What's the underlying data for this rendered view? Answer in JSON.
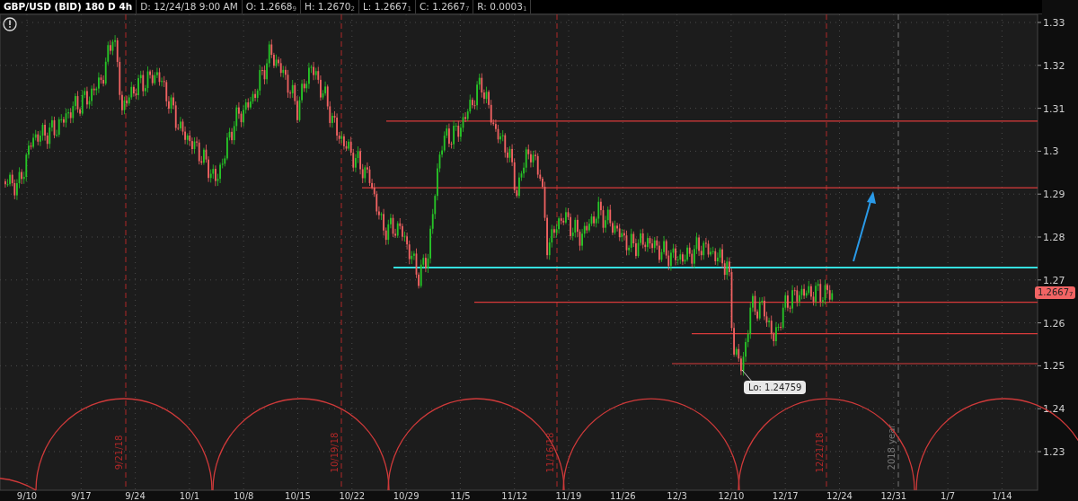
{
  "header": {
    "symbol": "GBP/USD (BID) 180 D 4h",
    "fields": [
      "D: 12/24/18 9:00 AM",
      "O: 1.2668$_{9}$",
      "H: 1.2670$_{2}$",
      "L: 1.2667$_{1}$",
      "C: 1.2667$_{7}$",
      "R: 0.0003$_{1}$"
    ]
  },
  "y_axis": {
    "ticks": [
      "1.33",
      "1.32",
      "1.31",
      "1.3",
      "1.29",
      "1.28",
      "1.27",
      "1.26",
      "1.25",
      "1.24",
      "1.23"
    ]
  },
  "price_tag": "1.2667$_{7}$",
  "x_axis": {
    "ticks": [
      "9/10",
      "9/17",
      "9/24",
      "10/1",
      "10/8",
      "10/15",
      "10/22",
      "10/29",
      "11/5",
      "11/12",
      "11/19",
      "11/26",
      "12/3",
      "12/10",
      "12/17",
      "12/24",
      "12/31",
      "1/7",
      "1/14"
    ]
  },
  "cycle_dates": [
    "9/21/18",
    "10/19/18",
    "11/16/18",
    "12/21/18"
  ],
  "year_marker": "2018 year",
  "low_label": "Lo: 1.24759"
}
